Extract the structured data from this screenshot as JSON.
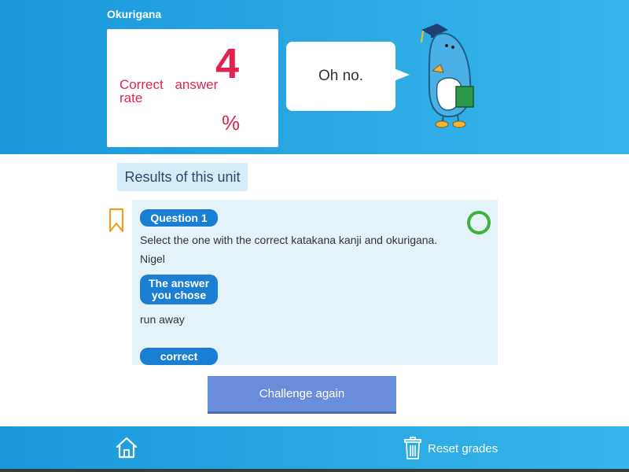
{
  "header": {
    "unit_title": "Okurigana"
  },
  "score": {
    "label": "Correct answer rate",
    "value": "4",
    "unit": "%"
  },
  "speech": {
    "text": "Oh no."
  },
  "results": {
    "title": "Results of this unit"
  },
  "question": {
    "number_label": "Question 1",
    "prompt": "Select the one with the correct katakana kanji and okurigana.",
    "choice": "Nigel",
    "chosen_label_line1": "The answer",
    "chosen_label_line2": "you chose",
    "chosen_answer": "run away",
    "correct_label": "correct answer",
    "result_icon": "circle-mark-icon"
  },
  "actions": {
    "challenge_again": "Challenge again"
  },
  "footer": {
    "home_icon": "home-icon",
    "reset_label": "Reset grades",
    "reset_icon": "trash-icon"
  },
  "colors": {
    "accent_blue": "#1a98dc",
    "score_red": "#e0234e",
    "button_blue": "#6b8edc",
    "correct_green": "#3cb43c",
    "bookmark_orange": "#f0a020"
  }
}
